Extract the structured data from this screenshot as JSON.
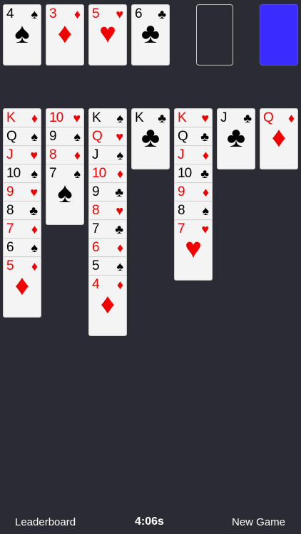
{
  "foundations": [
    {
      "rank": "4",
      "suit": "♠",
      "color": "black"
    },
    {
      "rank": "3",
      "suit": "♦",
      "color": "red"
    },
    {
      "rank": "5",
      "suit": "♥",
      "color": "red"
    },
    {
      "rank": "6",
      "suit": "♣",
      "color": "black"
    }
  ],
  "tableau": [
    [
      {
        "rank": "K",
        "suit": "♦",
        "color": "red"
      },
      {
        "rank": "Q",
        "suit": "♠",
        "color": "black"
      },
      {
        "rank": "J",
        "suit": "♥",
        "color": "red"
      },
      {
        "rank": "10",
        "suit": "♠",
        "color": "black"
      },
      {
        "rank": "9",
        "suit": "♥",
        "color": "red"
      },
      {
        "rank": "8",
        "suit": "♣",
        "color": "black"
      },
      {
        "rank": "7",
        "suit": "♦",
        "color": "red"
      },
      {
        "rank": "6",
        "suit": "♠",
        "color": "black"
      },
      {
        "rank": "5",
        "suit": "♦",
        "color": "red"
      }
    ],
    [
      {
        "rank": "10",
        "suit": "♥",
        "color": "red"
      },
      {
        "rank": "9",
        "suit": "♠",
        "color": "black"
      },
      {
        "rank": "8",
        "suit": "♦",
        "color": "red"
      },
      {
        "rank": "7",
        "suit": "♠",
        "color": "black"
      }
    ],
    [
      {
        "rank": "K",
        "suit": "♠",
        "color": "black"
      },
      {
        "rank": "Q",
        "suit": "♥",
        "color": "red"
      },
      {
        "rank": "J",
        "suit": "♠",
        "color": "black"
      },
      {
        "rank": "10",
        "suit": "♦",
        "color": "red"
      },
      {
        "rank": "9",
        "suit": "♣",
        "color": "black"
      },
      {
        "rank": "8",
        "suit": "♥",
        "color": "red"
      },
      {
        "rank": "7",
        "suit": "♣",
        "color": "black"
      },
      {
        "rank": "6",
        "suit": "♦",
        "color": "red"
      },
      {
        "rank": "5",
        "suit": "♠",
        "color": "black"
      },
      {
        "rank": "4",
        "suit": "♦",
        "color": "red"
      }
    ],
    [
      {
        "rank": "K",
        "suit": "♣",
        "color": "black"
      }
    ],
    [
      {
        "rank": "K",
        "suit": "♥",
        "color": "red"
      },
      {
        "rank": "Q",
        "suit": "♣",
        "color": "black"
      },
      {
        "rank": "J",
        "suit": "♦",
        "color": "red"
      },
      {
        "rank": "10",
        "suit": "♣",
        "color": "black"
      },
      {
        "rank": "9",
        "suit": "♦",
        "color": "red"
      },
      {
        "rank": "8",
        "suit": "♠",
        "color": "black"
      },
      {
        "rank": "7",
        "suit": "♥",
        "color": "red"
      }
    ],
    [
      {
        "rank": "J",
        "suit": "♣",
        "color": "black"
      }
    ],
    [
      {
        "rank": "Q",
        "suit": "♦",
        "color": "red"
      }
    ]
  ],
  "colors": {
    "red": "#f00000",
    "black": "#000000",
    "stock": "#3a2cff",
    "background": "#2b2b33"
  },
  "footer": {
    "leaderboard_label": "Leaderboard",
    "timer": "4:06s",
    "new_game_label": "New Game"
  }
}
